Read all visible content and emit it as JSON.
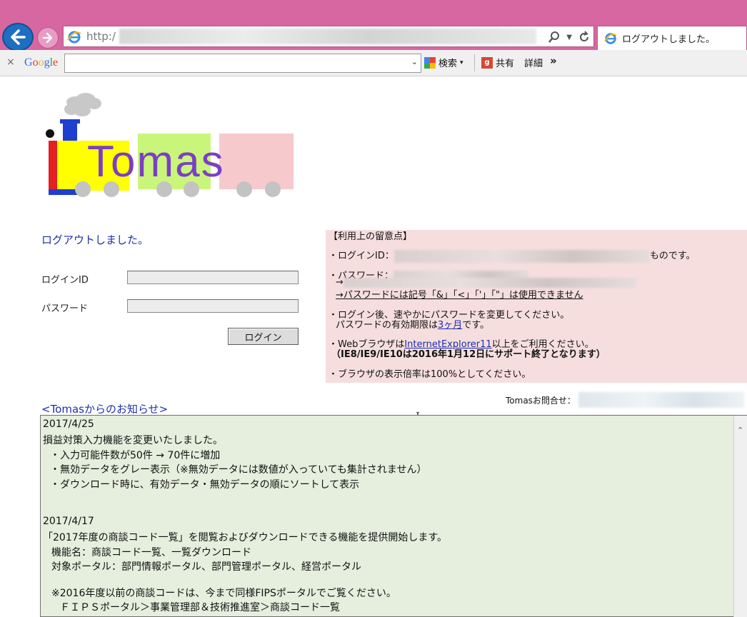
{
  "browser": {
    "url_prefix": "http:/",
    "tab_title": "ログアウトしました。",
    "toolbar": {
      "close": "×",
      "google": "Google",
      "search_label": "検索",
      "share_label": "共有",
      "detail_label": "詳細",
      "more": "»"
    }
  },
  "logo": {
    "text": "Tomas"
  },
  "login": {
    "message": "ログアウトしました。",
    "id_label": "ログインID",
    "password_label": "パスワード",
    "id_value": "",
    "password_value": "",
    "button_label": "ログイン"
  },
  "notes": {
    "heading": "【利用上の留意点】",
    "line1_prefix": "・ログインID：",
    "line1_suffix": "ものです。",
    "line2_prefix": "・パスワード：",
    "line2_arrow": "→",
    "line2_rule": "→パスワードには記号「&」「<」「'」「\"」は使用できません",
    "line3a": "・ログイン後、速やかにパスワードを変更してください。",
    "line3b_prefix": "パスワードの有効期限は",
    "line3b_link": "3ヶ月",
    "line3b_suffix": "です。",
    "line4_prefix": "・Webブラウザは",
    "line4_link": "InternetExplorer11",
    "line4_suffix": "以上をご利用ください。",
    "line4_note": "（IE8/IE9/IE10は2016年1月12日にサポート終了となります）",
    "line5": "・ブラウザの表示倍率は100%としてください。"
  },
  "contact": {
    "label": "Tomasお問合せ："
  },
  "news": {
    "heading": "<Tomasからのお知らせ>",
    "lines": [
      "2017/4/25",
      "損益対策入力機能を変更いたしました。",
      "・入力可能件数が50件 → 70件に増加",
      "・無効データをグレー表示（※無効データには数値が入っていても集計されません）",
      "・ダウンロード時に、有効データ・無効データの順にソートして表示",
      "2017/4/17",
      "「2017年度の商談コード一覧」を閲覧およびダウンロードできる機能を提供開始します。",
      "機能名：商談コード一覧、一覧ダウンロード",
      "対象ポータル：部門情報ポータル、部門管理ポータル、経営ポータル",
      "※2016年度以前の商談コードは、今まで同様FIPSポータルでご覧ください。",
      "ＦＩＰＳポータル＞事業管理部＆技術推進室＞商談コード一覧"
    ]
  }
}
